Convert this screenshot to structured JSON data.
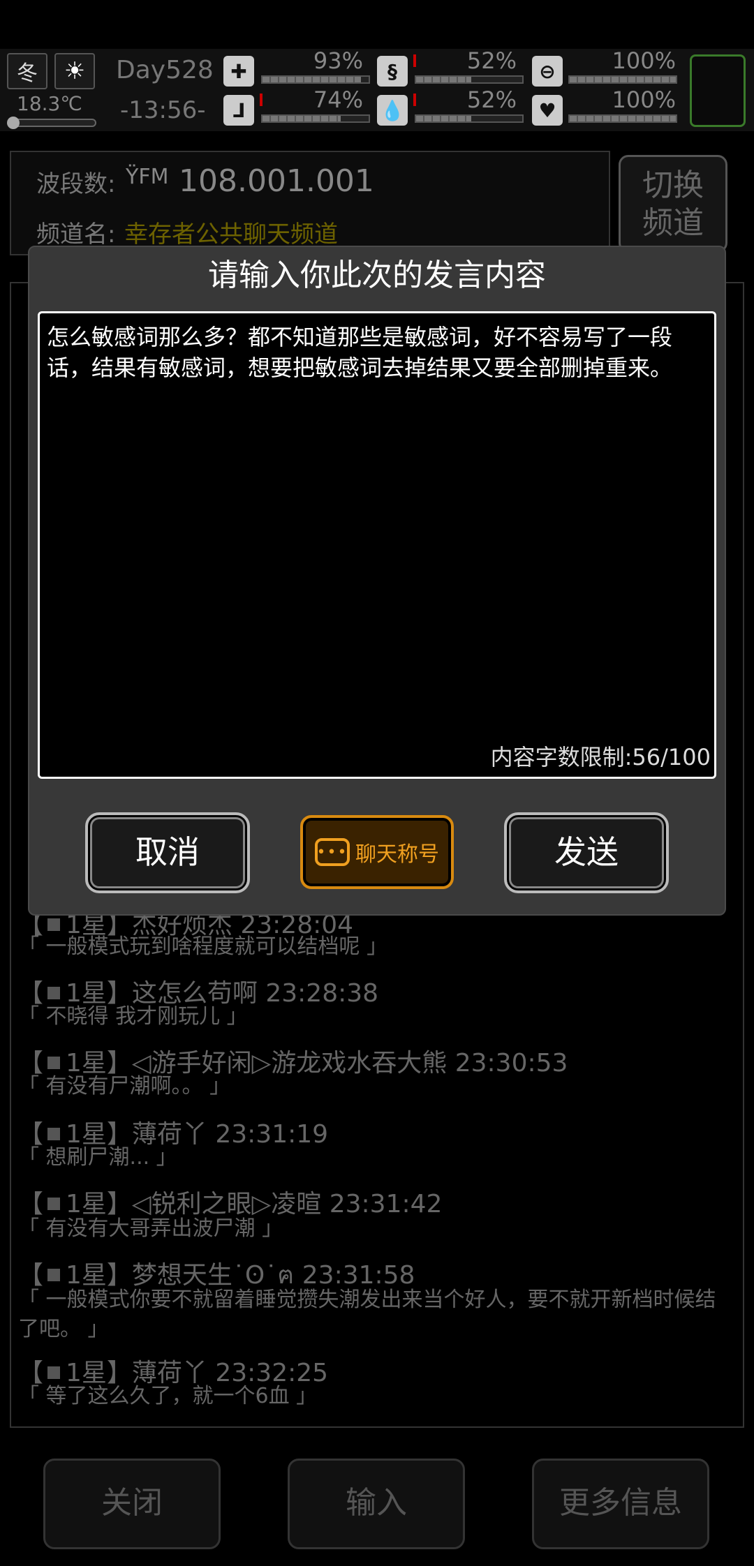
{
  "status": {
    "season": "冬",
    "weather_icon": "sun-icon",
    "temperature": "18.3℃",
    "temperature_level": 0.05,
    "day": "Day528",
    "time": "-13:56-",
    "stats": [
      {
        "name": "health",
        "icon": "first-aid-icon",
        "value": "93%",
        "level": 0.93
      },
      {
        "name": "hunger",
        "icon": "stomach-icon",
        "value": "52%",
        "level": 0.52
      },
      {
        "name": "energy",
        "icon": "pill-icon",
        "value": "100%",
        "level": 1.0
      },
      {
        "name": "stamina",
        "icon": "boot-icon",
        "value": "74%",
        "level": 0.74
      },
      {
        "name": "thirst",
        "icon": "water-drop-icon",
        "value": "52%",
        "level": 0.52
      },
      {
        "name": "mood",
        "icon": "heart-icon",
        "value": "100%",
        "level": 1.0
      }
    ]
  },
  "radio": {
    "freq_label": "波段数:",
    "freq_band": "FM",
    "frequency": "108.001.001",
    "channel_label": "频道名:",
    "channel_name": "幸存者公共聊天频道",
    "switch_line1": "切换",
    "switch_line2": "频道"
  },
  "chat": [
    {
      "head": "1星】杰好烦杰 23:28:04",
      "body": "「 一般模式玩到啥程度就可以结档呢 」"
    },
    {
      "head": "1星】这怎么苟啊 23:28:38",
      "body": "「 不晓得 我才刚玩儿 」"
    },
    {
      "head": "1星】◁游手好闲▷游龙戏水吞大熊 23:30:53",
      "body": "「 有没有尸潮啊。。 」"
    },
    {
      "head": "1星】薄荷丫 23:31:19",
      "body": "「 想刷尸潮... 」"
    },
    {
      "head": "1星】◁锐利之眼▷凌暄 23:31:42",
      "body": "「 有没有大哥弄出波尸潮 」"
    },
    {
      "head": "1星】梦想天生˙ʘ˙ฅ 23:31:58",
      "body": "「 一般模式你要不就留着睡觉攒失潮发出来当个好人，要不就开新档时候结了吧。 」"
    },
    {
      "head": "1星】薄荷丫 23:32:25",
      "body": "「 等了这么久了，就一个6血 」"
    }
  ],
  "bottom": {
    "close": "关闭",
    "input": "输入",
    "more": "更多信息"
  },
  "dialog": {
    "title": "请输入你此次的发言内容",
    "text": "怎么敏感词那么多？都不知道那些是敏感词，好不容易写了一段话，结果有敏感词，想要把敏感词去掉结果又要全部删掉重来。",
    "counter": "内容字数限制:56/100",
    "cancel": "取消",
    "chat_title": "聊天称号",
    "send": "发送"
  },
  "colors": {
    "channel": "#6d6200",
    "accent": "#f0a020",
    "slot_border": "#3a7a2a"
  }
}
